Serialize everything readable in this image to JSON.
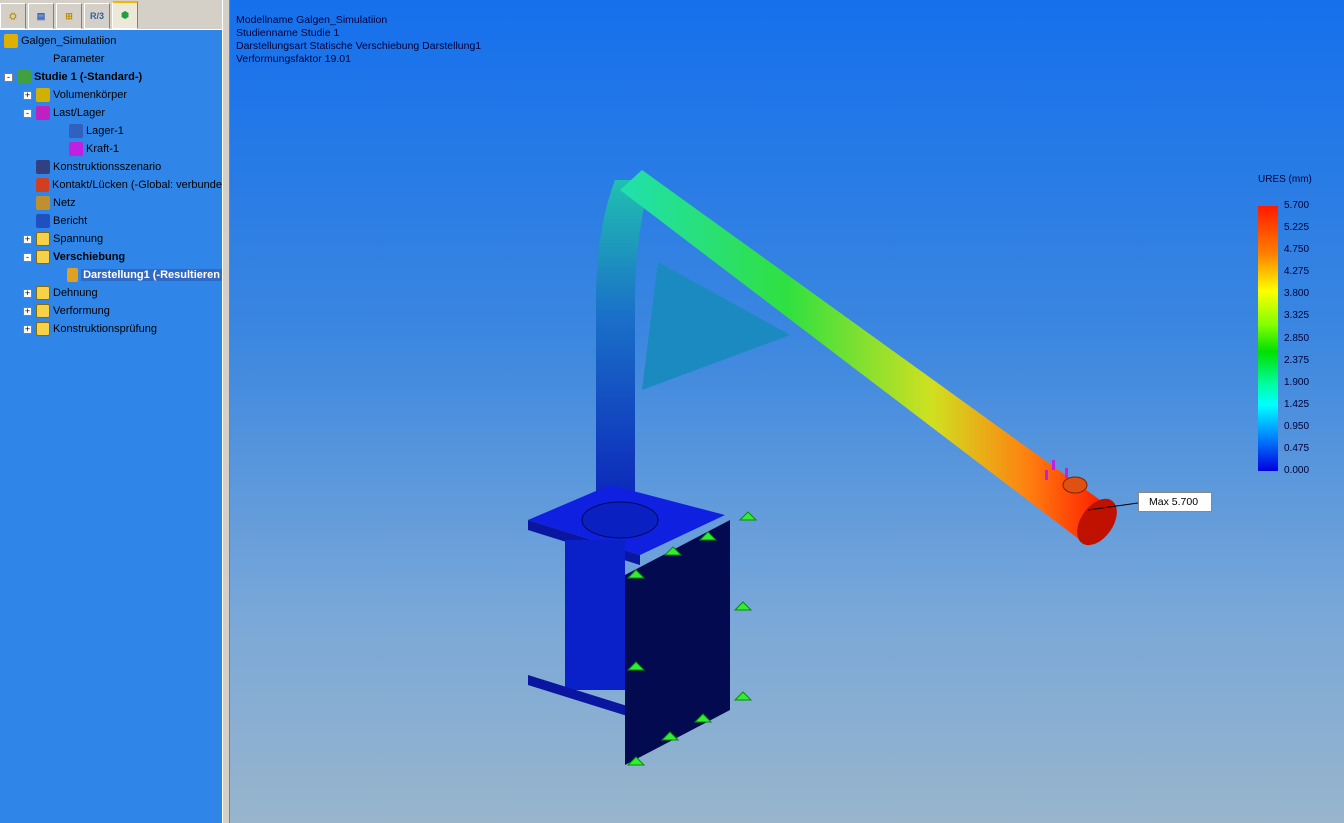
{
  "tabs": [
    {
      "icon": "feature-manager-icon"
    },
    {
      "icon": "property-manager-icon"
    },
    {
      "icon": "configuration-manager-icon"
    },
    {
      "label": "R/3",
      "icon": "dimxpert-icon"
    },
    {
      "icon": "simulation-icon"
    }
  ],
  "tree": [
    {
      "label": "Galgen_Simulatiion",
      "level": 0,
      "icon": "part-icon"
    },
    {
      "label": "Parameter",
      "level": 1,
      "icon": "parameter-icon"
    },
    {
      "label": "Studie 1 (-Standard-)",
      "level": 0,
      "expander": "-",
      "bold": true,
      "icon": "study-icon"
    },
    {
      "label": "Volumenkörper",
      "level": 1,
      "expander": "+",
      "icon": "solid-body-icon"
    },
    {
      "label": "Last/Lager",
      "level": 1,
      "expander": "-",
      "icon": "load-fixture-icon"
    },
    {
      "label": "Lager-1",
      "level": 2,
      "icon": "fixture-icon"
    },
    {
      "label": "Kraft-1",
      "level": 2,
      "icon": "force-icon"
    },
    {
      "label": "Konstruktionsszenario",
      "level": 1,
      "icon": "design-scenario-icon"
    },
    {
      "label": "Kontakt/Lücken (-Global: verbunde",
      "level": 1,
      "icon": "contact-icon"
    },
    {
      "label": "Netz",
      "level": 1,
      "icon": "mesh-icon"
    },
    {
      "label": "Bericht",
      "level": 1,
      "icon": "report-icon"
    },
    {
      "label": "Spannung",
      "level": 1,
      "expander": "+",
      "icon": "folder-icon"
    },
    {
      "label": "Verschiebung",
      "level": 1,
      "expander": "-",
      "bold": true,
      "icon": "folder-icon"
    },
    {
      "label": "Darstellung1 (-Resultieren",
      "level": 2,
      "selected": true,
      "icon": "plot-icon"
    },
    {
      "label": "Dehnung",
      "level": 1,
      "expander": "+",
      "icon": "folder-icon"
    },
    {
      "label": "Verformung",
      "level": 1,
      "expander": "+",
      "icon": "folder-icon"
    },
    {
      "label": "Konstruktionsprüfung",
      "level": 1,
      "expander": "+",
      "icon": "folder-icon"
    }
  ],
  "info": {
    "line1": "Modellname  Galgen_Simulatiion",
    "line2": "Studienname  Studie 1",
    "line3": "Darstellungsart  Statische Verschiebung Darstellung1",
    "line4": "Verformungsfaktor  19.01"
  },
  "legend": {
    "title": "URES (mm)",
    "ticks": [
      "5.700",
      "5.225",
      "4.750",
      "4.275",
      "3.800",
      "3.325",
      "2.850",
      "2.375",
      "1.900",
      "1.425",
      "0.950",
      "0.475",
      "0.000"
    ],
    "max": 5.7,
    "min": 0
  },
  "max_label": "Max  5.700"
}
